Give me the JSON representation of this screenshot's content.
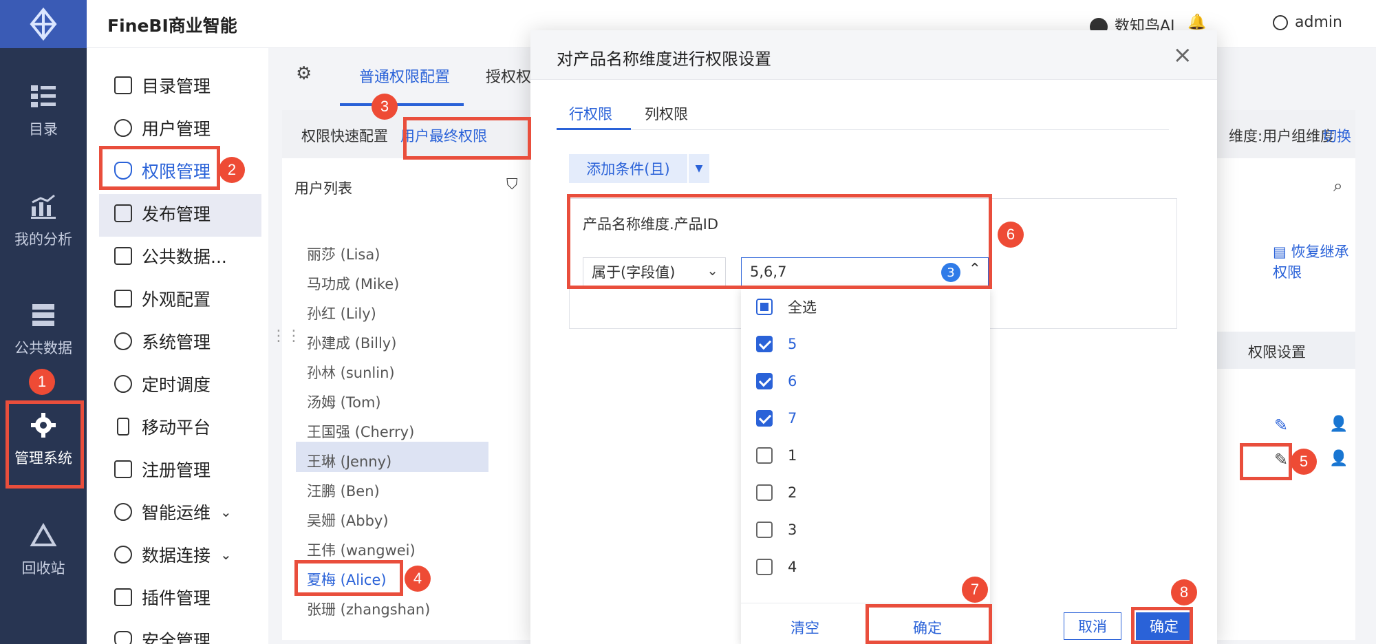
{
  "rail": {
    "items": [
      {
        "label": "目录",
        "icon": "catalog-icon"
      },
      {
        "label": "我的分析",
        "icon": "chart-icon"
      },
      {
        "label": "公共数据",
        "icon": "database-icon"
      },
      {
        "label": "管理系统",
        "icon": "gear-icon"
      },
      {
        "label": "回收站",
        "icon": "recycle-icon"
      }
    ]
  },
  "header": {
    "brand": "FineBI商业智能",
    "ai_label": "数知鸟AI",
    "user": "admin"
  },
  "menu": {
    "items": [
      {
        "label": "目录管理"
      },
      {
        "label": "用户管理"
      },
      {
        "label": "权限管理"
      },
      {
        "label": "发布管理"
      },
      {
        "label": "公共数据..."
      },
      {
        "label": "外观配置"
      },
      {
        "label": "系统管理"
      },
      {
        "label": "定时调度"
      },
      {
        "label": "移动平台"
      },
      {
        "label": "注册管理"
      },
      {
        "label": "智能运维"
      },
      {
        "label": "数据连接"
      },
      {
        "label": "插件管理"
      },
      {
        "label": "安全管理"
      }
    ]
  },
  "content": {
    "tabs": [
      "普通权限配置",
      "授权权"
    ],
    "subtabs": [
      "权限快速配置",
      "用户最终权限"
    ],
    "userlist_title": "用户列表",
    "users": [
      "丽莎 (Lisa)",
      "马功成 (Mike)",
      "孙红 (Lily)",
      "孙建成 (Billy)",
      "孙林 (sunlin)",
      "汤姆 (Tom)",
      "王国强 (Cherry)",
      "王琳 (Jenny)",
      "汪鹏 (Ben)",
      "吴姗 (Abby)",
      "王伟 (wangwei)",
      "夏梅 (Alice)",
      "张珊 (zhangshan)"
    ],
    "dimension_label": "维度:用户组维度",
    "switch_label": "切换",
    "restore_label": "恢复继承权限",
    "col_perm": "权限设置"
  },
  "modal": {
    "title": "对产品名称维度进行权限设置",
    "tabs": [
      "行权限",
      "列权限"
    ],
    "add_condition": "添加条件(且)",
    "field_label": "产品名称维度.产品ID",
    "operator": "属于(字段值)",
    "value": "5,6,7",
    "selected_count": "3",
    "options": [
      {
        "label": "全选",
        "state": "partial"
      },
      {
        "label": "5",
        "state": "checked"
      },
      {
        "label": "6",
        "state": "checked"
      },
      {
        "label": "7",
        "state": "checked"
      },
      {
        "label": "1",
        "state": "unchecked"
      },
      {
        "label": "2",
        "state": "unchecked"
      },
      {
        "label": "3",
        "state": "unchecked"
      },
      {
        "label": "4",
        "state": "unchecked"
      }
    ],
    "dd_clear": "清空",
    "dd_ok": "确定",
    "cancel": "取消",
    "ok": "确定"
  },
  "annotations": [
    "1",
    "2",
    "3",
    "4",
    "5",
    "6",
    "7",
    "8"
  ],
  "colors": {
    "accent": "#2a62d8",
    "annotation": "#ee4b35",
    "rail": "#283552"
  }
}
